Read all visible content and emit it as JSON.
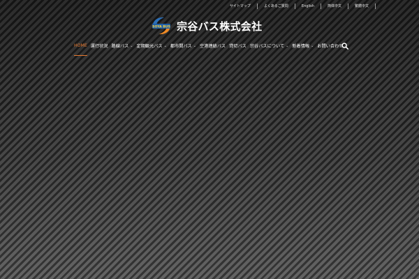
{
  "utility_links": [
    "サイトマップ",
    "よくあるご質問",
    "English",
    "简体中文",
    "繁體中文"
  ],
  "logo": {
    "mark_text": "SOYA BUS",
    "company_name": "宗谷バス株式会社"
  },
  "nav": [
    {
      "label": "HOME",
      "active": true,
      "dropdown": false
    },
    {
      "label": "運行状況",
      "active": false,
      "dropdown": false
    },
    {
      "label": "路線バス",
      "active": false,
      "dropdown": true
    },
    {
      "label": "定期観光バス",
      "active": false,
      "dropdown": true
    },
    {
      "label": "都市間バス",
      "active": false,
      "dropdown": true
    },
    {
      "label": "空港連絡バス",
      "active": false,
      "dropdown": false
    },
    {
      "label": "貸切バス",
      "active": false,
      "dropdown": false
    },
    {
      "label": "宗谷バスについて",
      "active": false,
      "dropdown": true
    },
    {
      "label": "新着情報",
      "active": false,
      "dropdown": true
    },
    {
      "label": "お問い合わせ",
      "active": false,
      "dropdown": false
    }
  ],
  "colors": {
    "accent": "#e8792f",
    "logo_blue": "#2c6fb7",
    "logo_orange": "#f08a24"
  },
  "icons": {
    "search": "search-icon",
    "dropdown": "chevron-down-icon"
  }
}
